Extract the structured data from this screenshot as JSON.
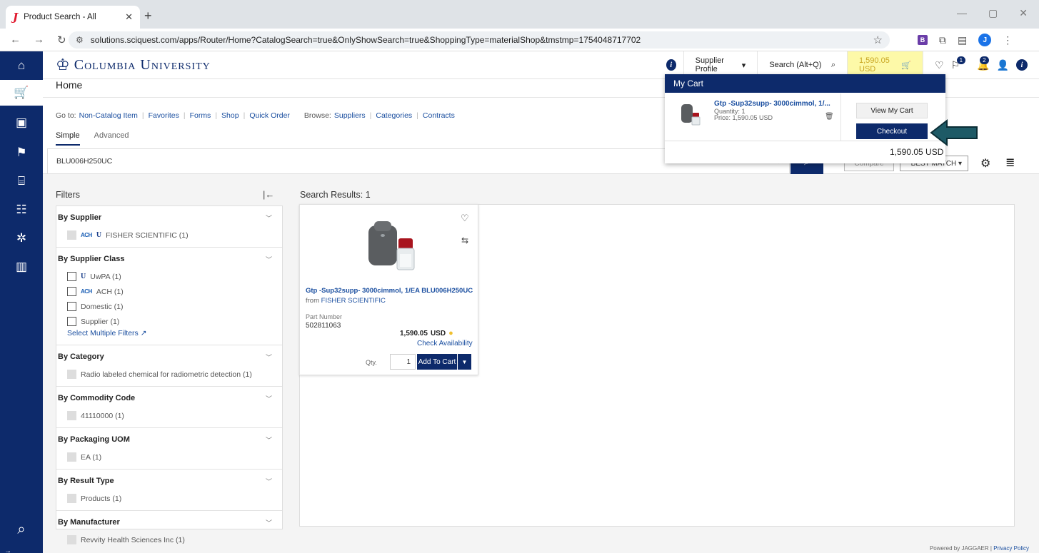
{
  "browser": {
    "tab_title": "Product Search - All",
    "url": "solutions.sciquest.com/apps/Router/Home?CatalogSearch=true&OnlyShowSearch=true&ShoppingType=materialShop&tmstmp=1754048717702",
    "ext_b": "B",
    "profile_initial": "J"
  },
  "header": {
    "university": "Columbia University",
    "supplier_profile": "Supplier Profile",
    "search_hint": "Search (Alt+Q)",
    "cart_total": "1,590.05 USD",
    "notif_badge_1": "1",
    "notif_badge_2": "2"
  },
  "page": {
    "home": "Home"
  },
  "goto": {
    "goto_label": "Go to:",
    "goto_links": [
      "Non-Catalog Item",
      "Favorites",
      "Forms",
      "Shop",
      "Quick Order"
    ],
    "browse_label": "Browse:",
    "browse_links": [
      "Suppliers",
      "Categories",
      "Contracts"
    ]
  },
  "search": {
    "tab_simple": "Simple",
    "tab_advanced": "Advanced",
    "query": "BLU006H250UC",
    "compare": "Compare",
    "sort": "BEST MATCH"
  },
  "filters": {
    "title": "Filters",
    "groups": [
      {
        "label": "By Supplier",
        "options": [
          {
            "text": "FISHER SCIENTIFIC (1)",
            "logos": [
              "ACH",
              "U"
            ],
            "disabled": true
          }
        ]
      },
      {
        "label": "By Supplier Class",
        "options": [
          {
            "text": "UwPA (1)",
            "logos": [
              "U"
            ],
            "disabled": false
          },
          {
            "text": "ACH (1)",
            "logos": [
              "ACH"
            ],
            "disabled": false
          },
          {
            "text": "Domestic (1)",
            "logos": [],
            "disabled": false
          },
          {
            "text": "Supplier (1)",
            "logos": [],
            "disabled": false
          }
        ],
        "select_multiple": "Select Multiple Filters"
      },
      {
        "label": "By Category",
        "options": [
          {
            "text": "Radio labeled chemical for radiometric detection (1)",
            "logos": [],
            "disabled": true
          }
        ]
      },
      {
        "label": "By Commodity Code",
        "options": [
          {
            "text": "41110000 (1)",
            "logos": [],
            "disabled": true
          }
        ]
      },
      {
        "label": "By Packaging UOM",
        "options": [
          {
            "text": "EA (1)",
            "logos": [],
            "disabled": true
          }
        ]
      },
      {
        "label": "By Result Type",
        "options": [
          {
            "text": "Products (1)",
            "logos": [],
            "disabled": true
          }
        ]
      },
      {
        "label": "By Manufacturer",
        "options": [
          {
            "text": "Revvity Health Sciences Inc (1)",
            "logos": [],
            "disabled": true
          }
        ]
      }
    ]
  },
  "results": {
    "title": "Search Results: 1",
    "product": {
      "name": "Gtp -Sup32supp- 3000cimmol, 1/EA BLU006H250UC",
      "from_label": "from",
      "supplier": "FISHER SCIENTIFIC",
      "part_label": "Part Number",
      "part_number": "502811063",
      "price": "1,590.05",
      "currency": "USD",
      "check_availability": "Check Availability",
      "qty_label": "Qty.",
      "qty": "1",
      "add_to_cart": "Add To Cart"
    }
  },
  "cart": {
    "title": "My Cart",
    "item_name": "Gtp -Sup32supp- 3000cimmol, 1/...",
    "quantity": "Quantity: 1",
    "price": "Price: 1,590.05 USD",
    "view_cart": "View My Cart",
    "checkout": "Checkout",
    "total": "1,590.05 USD"
  },
  "footer": {
    "powered": "Powered by JAGGAER | ",
    "privacy": "Privacy Policy"
  },
  "colors": {
    "navy": "#0d2a6b",
    "link": "#1b4fa0",
    "cart_highlight": "#fdf9a8",
    "arrow": "#1e5a66"
  }
}
